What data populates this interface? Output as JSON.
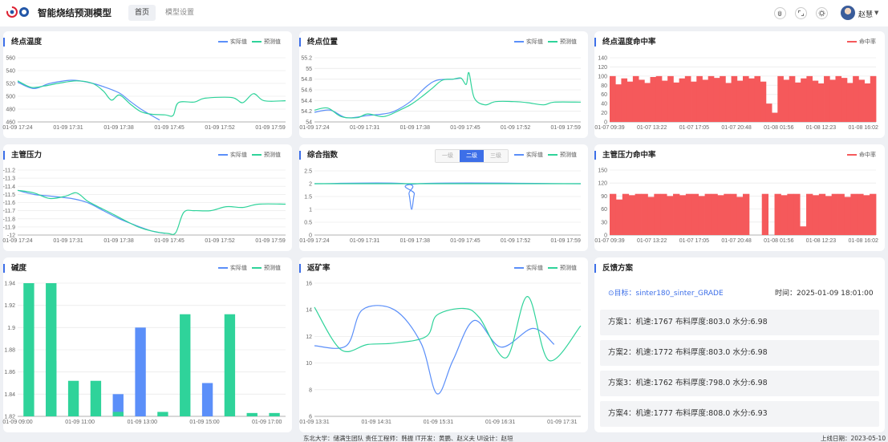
{
  "header": {
    "title": "智能烧结预测模型",
    "tabs": [
      {
        "label": "首页"
      },
      {
        "label": "模型设置"
      }
    ],
    "user": "赵慧"
  },
  "colors": {
    "actual": "#5b8ff9",
    "predicted": "#2fd39a",
    "hit": "#f5595b",
    "accent": "#3d6fe8"
  },
  "legend": {
    "actual": "实际值",
    "predicted": "预测值",
    "hit": "命中率"
  },
  "times7": [
    "01-09 17:24",
    "01-09 17:31",
    "01-09 17:38",
    "01-09 17:45",
    "01-09 17:52",
    "01-09 17:59"
  ],
  "hit_times": [
    "01-07 09:39",
    "01-07 13:22",
    "01-07 17:05",
    "01-07 20:48",
    "01-08 01:56",
    "01-08 12:23",
    "01-08 16:02"
  ],
  "chart_data": [
    {
      "type": "line",
      "title": "终点温度",
      "ylim": [
        460,
        560
      ],
      "yticks": [
        "560",
        "540",
        "520",
        "500",
        "480",
        "460"
      ],
      "x": [
        "01-09 17:24",
        "01-09 17:31",
        "01-09 17:38",
        "01-09 17:45",
        "01-09 17:52",
        "01-09 17:59"
      ],
      "series": [
        {
          "name": "实际值",
          "points": [
            [
              0,
              522
            ],
            [
              0.06,
              512
            ],
            [
              0.12,
              520
            ],
            [
              0.2,
              525
            ],
            [
              0.26,
              522
            ],
            [
              0.32,
              515
            ],
            [
              0.38,
              505
            ],
            [
              0.42,
              492
            ],
            [
              0.46,
              480
            ],
            [
              0.5,
              470
            ],
            [
              0.53,
              463
            ]
          ]
        },
        {
          "name": "预测值",
          "points": [
            [
              0,
              524
            ],
            [
              0.05,
              514
            ],
            [
              0.1,
              516
            ],
            [
              0.15,
              520
            ],
            [
              0.22,
              524
            ],
            [
              0.28,
              520
            ],
            [
              0.32,
              508
            ],
            [
              0.35,
              494
            ],
            [
              0.38,
              502
            ],
            [
              0.42,
              488
            ],
            [
              0.46,
              476
            ],
            [
              0.5,
              472
            ],
            [
              0.55,
              471
            ],
            [
              0.58,
              470
            ],
            [
              0.6,
              490
            ],
            [
              0.66,
              491
            ],
            [
              0.7,
              497
            ],
            [
              0.8,
              498
            ],
            [
              0.84,
              490
            ],
            [
              0.88,
              504
            ],
            [
              0.92,
              493
            ],
            [
              1.0,
              493
            ]
          ]
        }
      ]
    },
    {
      "type": "line",
      "title": "终点位置",
      "ylim": [
        54,
        55.2
      ],
      "yticks": [
        "55.2",
        "55",
        "54.8",
        "54.6",
        "54.4",
        "54.2",
        "54"
      ],
      "x": [
        "01-09 17:24",
        "01-09 17:31",
        "01-09 17:38",
        "01-09 17:45",
        "01-09 17:52",
        "01-09 17:59"
      ],
      "series": [
        {
          "name": "实际值",
          "points": [
            [
              0,
              54.18
            ],
            [
              0.06,
              54.22
            ],
            [
              0.12,
              54.08
            ],
            [
              0.2,
              54.12
            ],
            [
              0.26,
              54.15
            ],
            [
              0.3,
              54.2
            ],
            [
              0.36,
              54.38
            ],
            [
              0.42,
              54.66
            ],
            [
              0.46,
              54.78
            ],
            [
              0.52,
              54.8
            ],
            [
              0.55,
              54.82
            ]
          ]
        },
        {
          "name": "预测值",
          "points": [
            [
              0,
              54.22
            ],
            [
              0.05,
              54.26
            ],
            [
              0.1,
              54.1
            ],
            [
              0.16,
              54.08
            ],
            [
              0.2,
              54.15
            ],
            [
              0.26,
              54.1
            ],
            [
              0.32,
              54.22
            ],
            [
              0.36,
              54.32
            ],
            [
              0.4,
              54.46
            ],
            [
              0.44,
              54.62
            ],
            [
              0.48,
              54.78
            ],
            [
              0.52,
              54.8
            ],
            [
              0.55,
              54.82
            ],
            [
              0.57,
              54.7
            ],
            [
              0.58,
              54.92
            ],
            [
              0.6,
              54.45
            ],
            [
              0.64,
              54.32
            ],
            [
              0.68,
              54.38
            ],
            [
              0.75,
              54.38
            ],
            [
              0.8,
              54.36
            ],
            [
              0.86,
              54.32
            ],
            [
              0.9,
              54.37
            ],
            [
              1.0,
              54.37
            ]
          ]
        }
      ]
    },
    {
      "type": "bar",
      "title": "终点温度命中率",
      "ylim": [
        0,
        140
      ],
      "yticks": [
        "140",
        "120",
        "100",
        "80",
        "60",
        "40",
        "20",
        "0"
      ],
      "x": [
        "01-07 09:39",
        "01-07 13:22",
        "01-07 17:05",
        "01-07 20:48",
        "01-08 01:56",
        "01-08 12:23",
        "01-08 16:02"
      ],
      "series": [
        {
          "name": "命中率",
          "values": [
            100,
            82,
            95,
            88,
            100,
            92,
            85,
            98,
            100,
            90,
            100,
            86,
            95,
            100,
            88,
            100,
            92,
            100,
            96,
            100,
            85,
            100,
            90,
            100,
            95,
            100,
            88,
            40,
            20,
            100,
            92,
            100,
            86,
            95,
            100,
            90,
            84,
            100,
            92,
            100,
            96,
            85,
            100,
            92,
            84,
            100
          ]
        }
      ]
    },
    {
      "type": "line",
      "title": "主管压力",
      "ylim": [
        -12,
        -11.2
      ],
      "yticks": [
        "-11.2",
        "-11.3",
        "-11.4",
        "-11.5",
        "-11.6",
        "-11.7",
        "-11.8",
        "-11.9",
        "-12"
      ],
      "x": [
        "01-09 17:24",
        "01-09 17:31",
        "01-09 17:38",
        "01-09 17:45",
        "01-09 17:52",
        "01-09 17:59"
      ],
      "series": [
        {
          "name": "实际值",
          "points": [
            [
              0,
              -11.45
            ],
            [
              0.06,
              -11.5
            ],
            [
              0.12,
              -11.52
            ],
            [
              0.2,
              -11.55
            ],
            [
              0.26,
              -11.6
            ],
            [
              0.32,
              -11.7
            ],
            [
              0.38,
              -11.8
            ],
            [
              0.44,
              -11.88
            ],
            [
              0.5,
              -11.95
            ],
            [
              0.55,
              -11.98
            ]
          ]
        },
        {
          "name": "预测值",
          "points": [
            [
              0,
              -11.45
            ],
            [
              0.06,
              -11.48
            ],
            [
              0.12,
              -11.55
            ],
            [
              0.18,
              -11.52
            ],
            [
              0.22,
              -11.48
            ],
            [
              0.26,
              -11.58
            ],
            [
              0.3,
              -11.65
            ],
            [
              0.36,
              -11.75
            ],
            [
              0.4,
              -11.82
            ],
            [
              0.45,
              -11.9
            ],
            [
              0.5,
              -11.95
            ],
            [
              0.56,
              -11.98
            ],
            [
              0.59,
              -11.97
            ],
            [
              0.62,
              -11.72
            ],
            [
              0.66,
              -11.7
            ],
            [
              0.72,
              -11.7
            ],
            [
              0.78,
              -11.65
            ],
            [
              0.84,
              -11.66
            ],
            [
              0.9,
              -11.62
            ],
            [
              1.0,
              -11.62
            ]
          ]
        }
      ]
    },
    {
      "type": "line",
      "title": "综合指数",
      "ylim": [
        0,
        2.5
      ],
      "yticks": [
        "2.5",
        "2",
        "1.5",
        "1",
        "0.5",
        "0"
      ],
      "x": [
        "01-09 17:24",
        "01-09 17:31",
        "01-09 17:38",
        "01-09 17:45",
        "01-09 17:52",
        "01-09 17:59"
      ],
      "segments": [
        "一级",
        "二级",
        "三级"
      ],
      "active_segment": 1,
      "series": [
        {
          "name": "实际值",
          "points": [
            [
              0,
              2
            ],
            [
              0.34,
              2
            ],
            [
              0.355,
              1.6
            ],
            [
              0.365,
              1.0
            ],
            [
              0.375,
              1.6
            ],
            [
              0.39,
              2
            ],
            [
              1,
              2
            ]
          ]
        },
        {
          "name": "预测值",
          "points": [
            [
              0,
              2
            ],
            [
              1,
              2
            ]
          ]
        }
      ]
    },
    {
      "type": "bar",
      "title": "主管压力命中率",
      "ylim": [
        0,
        150
      ],
      "yticks": [
        "150",
        "120",
        "90",
        "60",
        "30",
        "0"
      ],
      "x": [
        "01-07 09:39",
        "01-07 13:22",
        "01-07 17:05",
        "01-07 20:48",
        "01-08 01:56",
        "01-08 12:23",
        "01-08 16:02"
      ],
      "series": [
        {
          "name": "命中率",
          "values": [
            95,
            82,
            95,
            92,
            95,
            95,
            88,
            95,
            95,
            90,
            95,
            92,
            95,
            95,
            90,
            95,
            95,
            92,
            95,
            95,
            88,
            95,
            0,
            0,
            95,
            0,
            95,
            92,
            95,
            95,
            20,
            95,
            92,
            95,
            90,
            95,
            95,
            88,
            95,
            95,
            92,
            95
          ]
        }
      ]
    },
    {
      "type": "bar",
      "title": "碱度",
      "ylim": [
        1.82,
        1.94
      ],
      "yticks": [
        "1.94",
        "1.92",
        "1.9",
        "1.88",
        "1.86",
        "1.84",
        "1.82"
      ],
      "x": [
        "01-09 09:00",
        "01-09 11:00",
        "01-09 13:00",
        "01-09 15:00",
        "01-09 17:00"
      ],
      "series": [
        {
          "name": "实际值",
          "values": [
            null,
            1.87,
            null,
            null,
            1.84,
            1.9,
            null,
            null,
            1.85,
            null,
            null,
            null
          ]
        },
        {
          "name": "预测值",
          "values": [
            1.94,
            1.94,
            1.852,
            1.852,
            1.824,
            null,
            1.824,
            1.912,
            null,
            1.912,
            1.823,
            1.823
          ]
        }
      ]
    },
    {
      "type": "line",
      "title": "返矿率",
      "ylim": [
        6,
        16
      ],
      "yticks": [
        "16",
        "14",
        "12",
        "10",
        "8",
        "6"
      ],
      "x": [
        "01-09 13:31",
        "01-09 14:31",
        "01-09 15:31",
        "01-09 16:31",
        "01-09 17:31"
      ],
      "series": [
        {
          "name": "实际值",
          "points": [
            [
              0,
              11.3
            ],
            [
              0.12,
              11.3
            ],
            [
              0.18,
              14.0
            ],
            [
              0.3,
              14.0
            ],
            [
              0.4,
              11.5
            ],
            [
              0.46,
              7.7
            ],
            [
              0.52,
              10.2
            ],
            [
              0.6,
              13.2
            ],
            [
              0.7,
              11.2
            ],
            [
              0.82,
              12.6
            ],
            [
              0.9,
              11.4
            ]
          ]
        },
        {
          "name": "预测值",
          "points": [
            [
              0,
              14.2
            ],
            [
              0.1,
              11.0
            ],
            [
              0.2,
              11.4
            ],
            [
              0.3,
              11.5
            ],
            [
              0.42,
              12.0
            ],
            [
              0.46,
              13.6
            ],
            [
              0.56,
              14.1
            ],
            [
              0.62,
              13.4
            ],
            [
              0.72,
              10.4
            ],
            [
              0.8,
              15.0
            ],
            [
              0.88,
              10.2
            ],
            [
              1.0,
              12.8
            ]
          ]
        }
      ]
    }
  ],
  "feedback": {
    "title": "反馈方案",
    "target": "⊙目标：sinter180_sinter_GRADE",
    "time": "时间：2025-01-09 18:01:00",
    "plans": [
      "方案1：机速:1767 布料厚度:803.0 水分:6.98",
      "方案2：机速:1772 布料厚度:803.0 水分:6.98",
      "方案3：机速:1762 布料厚度:798.0 水分:6.98",
      "方案4：机速:1777 布料厚度:808.0 水分:6.93"
    ]
  },
  "footer": {
    "credits": "东北大学：储满生团队  责任工程师：韩振  IT开发：黄鹏、赵义夫  UI设计：赵垣",
    "date": "上线日期：2023-05-10"
  }
}
